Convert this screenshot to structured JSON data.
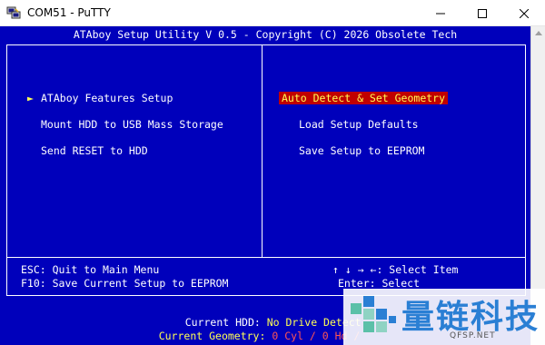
{
  "window": {
    "title": "COM51 - PuTTY",
    "controls": {
      "minimize": "minimize",
      "maximize": "maximize",
      "close": "close"
    }
  },
  "terminal": {
    "header": "ATAboy Setup Utility V 0.5 - Copyright (C) 2026 Obsolete Tech",
    "left_menu": [
      {
        "label": "ATAboy Features Setup",
        "selected": true
      },
      {
        "label": "Mount HDD to USB Mass Storage",
        "selected": false
      },
      {
        "label": "Send RESET to HDD",
        "selected": false
      }
    ],
    "selection_marker": "►",
    "right_menu": [
      {
        "label": "Auto Detect & Set Geometry",
        "highlighted": true
      },
      {
        "label": "Load Setup Defaults",
        "highlighted": false
      },
      {
        "label": "Save Setup to EEPROM",
        "highlighted": false
      }
    ],
    "help": {
      "esc": "ESC: Quit to Main Menu",
      "f10": "F10: Save Current Setup to EEPROM",
      "arrows": "↑ ↓ → ←: Select Item",
      "enter": "Enter: Select"
    },
    "status": {
      "hdd_label": "Current HDD:",
      "hdd_value": "No Drive Detect",
      "geometry_label": "Current Geometry:",
      "geometry_value": "0 Cyl / 0 Hd /"
    }
  },
  "watermark": {
    "text": "量链科技",
    "sub": "QFSP.NET"
  },
  "colors": {
    "terminal_bg": "#0000bb",
    "text": "#ffffff",
    "highlight_bg": "#c00000",
    "highlight_fg": "#ffff55",
    "value_red": "#ff5555"
  }
}
